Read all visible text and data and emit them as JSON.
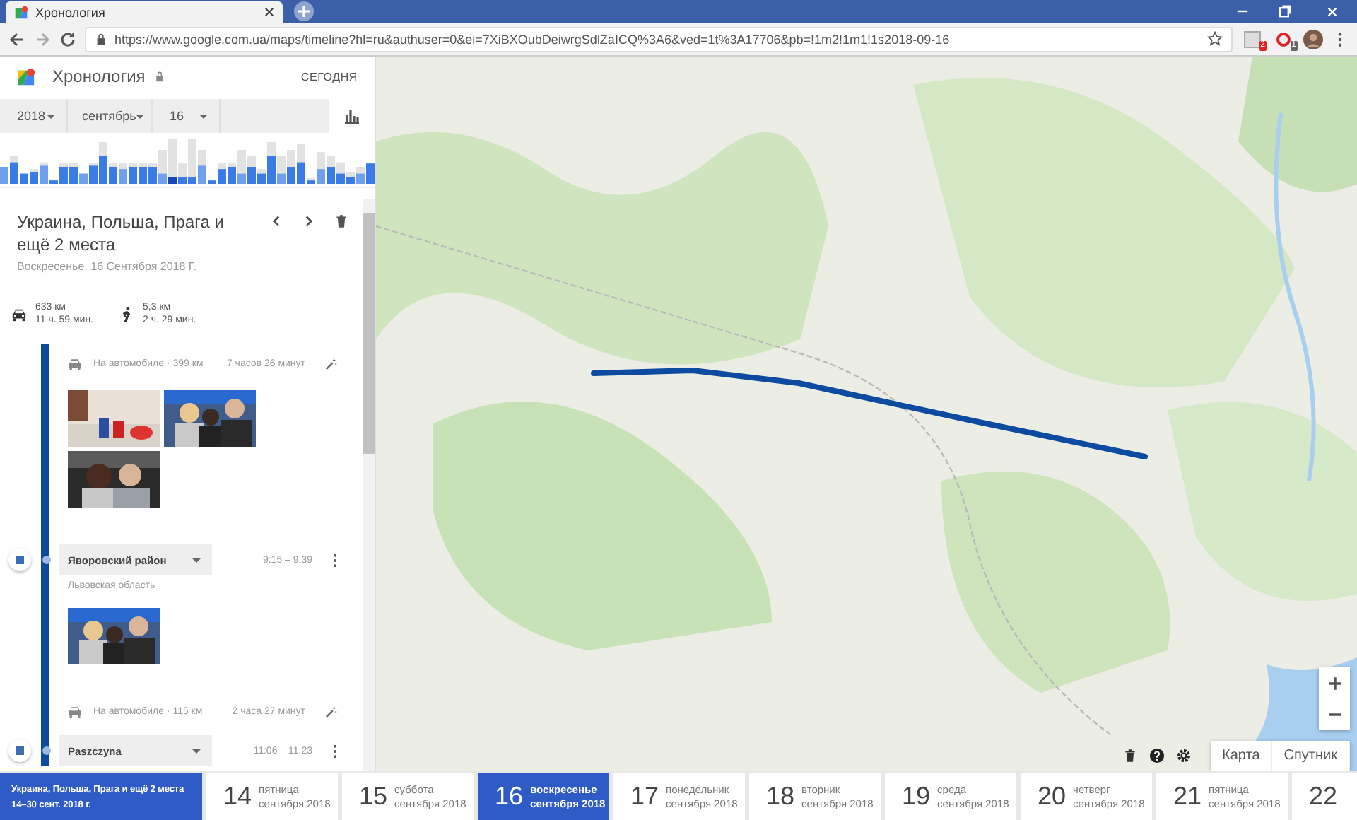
{
  "browser": {
    "tab_title": "Хронология",
    "url": "https://www.google.com.ua/maps/timeline?hl=ru&authuser=0&ei=7XiBXOubDeiwrgSdlZaICQ%3A6&ved=1t%3A17706&pb=!1m2!1m1!1s2018-09-16",
    "badges": [
      "2",
      "1"
    ]
  },
  "header": {
    "title": "Хронология",
    "today_button": "СЕГОДНЯ"
  },
  "date_pickers": [
    {
      "value": "2018"
    },
    {
      "value": "сентябрь"
    },
    {
      "value": "16"
    }
  ],
  "day": {
    "title": "Украина, Польша, Прага и ещё 2 места",
    "date": "Воскресенье, 16 Сентября 2018 Г."
  },
  "summary": [
    {
      "kind": "car",
      "distance": "633 км",
      "duration": "11 ч. 59 мин."
    },
    {
      "kind": "walk",
      "distance": "5,3 км",
      "duration": "2 ч. 29 мин."
    }
  ],
  "timeline": [
    {
      "kind": "move",
      "label": "На автомобиле · 399 км",
      "duration": "7 часов 26 минут"
    },
    {
      "kind": "place",
      "name": "Яворовский район",
      "time": "9:15 – 9:39",
      "region": "Львовская область"
    },
    {
      "kind": "move",
      "label": "На автомобиле · 115 км",
      "duration": "2 часа 27 минут"
    },
    {
      "kind": "place",
      "name": "Paszczyna",
      "time": "11:06 – 11:23"
    }
  ],
  "map": {
    "kind": "picture",
    "map_types": [
      "Карта",
      "Спутник"
    ]
  },
  "date_strip": {
    "trip": {
      "title": "Украина, Польша, Прага и ещё 2 места",
      "range": "14–30 сент. 2018 г."
    },
    "days": [
      {
        "number": "14",
        "weekday": "пятница",
        "month": "сентября 2018",
        "selected": false
      },
      {
        "number": "15",
        "weekday": "суббота",
        "month": "сентября 2018",
        "selected": false
      },
      {
        "number": "16",
        "weekday": "воскресенье",
        "month": "сентября 2018",
        "selected": true
      },
      {
        "number": "17",
        "weekday": "понедельник",
        "month": "сентября 2018",
        "selected": false
      },
      {
        "number": "18",
        "weekday": "вторник",
        "month": "сентября 2018",
        "selected": false
      },
      {
        "number": "19",
        "weekday": "среда",
        "month": "сентября 2018",
        "selected": false
      },
      {
        "number": "20",
        "weekday": "четверг",
        "month": "сентября 2018",
        "selected": false
      },
      {
        "number": "21",
        "weekday": "пятница",
        "month": "сентября 2018",
        "selected": false
      },
      {
        "number": "22",
        "selected": false
      }
    ]
  }
}
